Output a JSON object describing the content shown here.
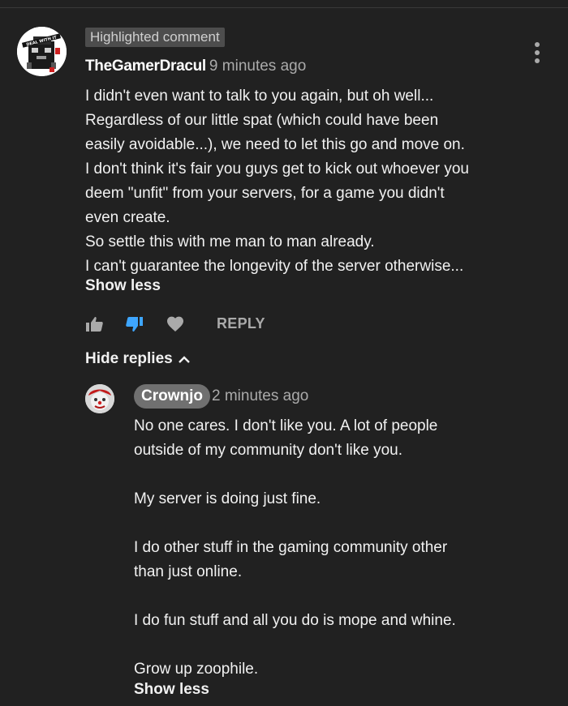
{
  "comment": {
    "badge": "Highlighted comment",
    "author": "TheGamerDracul",
    "time": "9 minutes ago",
    "avatar_text": "DEAL WITH IT",
    "lines": [
      "I didn't even want to talk  to you again, but oh well...",
      "Regardless of our little spat (which could have been",
      "easily avoidable...), we need to let this go and move on.",
      "I don't think it's fair you guys get to kick out whoever you",
      "deem \"unfit\" from your servers, for a game you didn't",
      "even create.",
      "So settle this with me man to man already.",
      "I can't guarantee the longevity of the server otherwise..."
    ],
    "show_less": "Show less",
    "reply_label": "REPLY",
    "hide_replies": "Hide replies",
    "accent_color": "#3ea6ff"
  },
  "reply": {
    "author": "Crownjo",
    "time": "2 minutes ago",
    "lines": [
      "No one cares. I don't like you. A lot of people",
      "outside of my community don't like you.",
      "",
      "My server is doing just fine.",
      "",
      "I do other stuff in the gaming community other",
      "than just online.",
      "",
      "I do fun stuff and all you do is mope and whine.",
      "",
      "Grow up zoophile."
    ],
    "show_less": "Show less"
  },
  "icons": {
    "menu": "more-vert-icon",
    "like": "thumb-up-icon",
    "dislike": "thumb-down-icon",
    "heart": "heart-icon",
    "chevron": "chevron-up-icon"
  }
}
